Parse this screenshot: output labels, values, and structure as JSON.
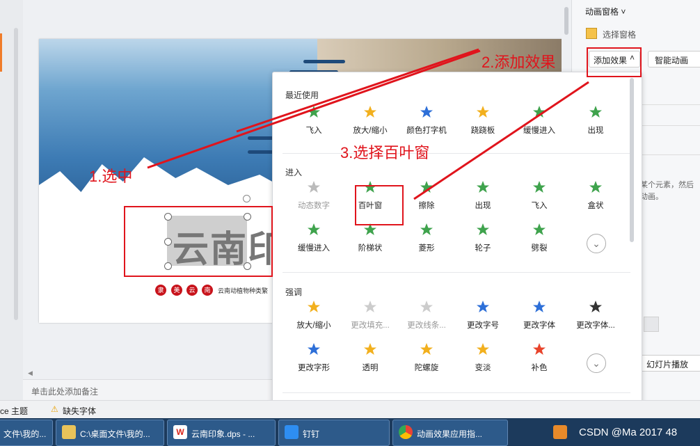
{
  "notes_placeholder": "单击此处添加备注",
  "slide": {
    "title": "云南印",
    "circles": [
      "隶",
      "美",
      "云",
      "南"
    ],
    "subtitle": "云南动植物种类繁"
  },
  "right_panel": {
    "title": "动画窗格",
    "select_pane": "选择窗格",
    "add_effect": "添加效果",
    "smart_anim": "智能动画",
    "hint_line1": "某个元素，然后",
    "hint_line2": "动画。",
    "slideshow_btn": "幻灯片播放"
  },
  "popup": {
    "sections": [
      {
        "title": "最近使用",
        "items": [
          "飞入",
          "放大/缩小",
          "颜色打字机",
          "跷跷板",
          "缓慢进入",
          "出现"
        ]
      },
      {
        "title": "进入",
        "items": [
          "动态数字",
          "百叶窗",
          "擦除",
          "出现",
          "飞入",
          "盒状",
          "缓慢进入",
          "阶梯状",
          "菱形",
          "轮子",
          "劈裂"
        ]
      },
      {
        "title": "强调",
        "items": [
          "放大/缩小",
          "更改填充...",
          "更改线条...",
          "更改字号",
          "更改字体",
          "更改字体...",
          "更改字形",
          "透明",
          "陀螺旋",
          "变淡",
          "补色"
        ]
      }
    ],
    "footer": "···"
  },
  "status": {
    "theme": "ce 主题",
    "missing_font": "缺失字体"
  },
  "taskbar": {
    "items": [
      "文件\\我的...",
      "C:\\桌面文件\\我的...",
      "云南印象.dps - ...",
      "钉钉",
      "动画效果应用指..."
    ],
    "tray": "CSDN @Ma 2017 48"
  },
  "annotations": {
    "step1": "1.选中",
    "step2": "2.添加效果",
    "step3": "3.选择百叶窗"
  },
  "colors": {
    "annotation": "#e0141c",
    "accent": "#f07c2a",
    "star_green": "#3fa34d",
    "star_gold": "#f2b01e"
  }
}
